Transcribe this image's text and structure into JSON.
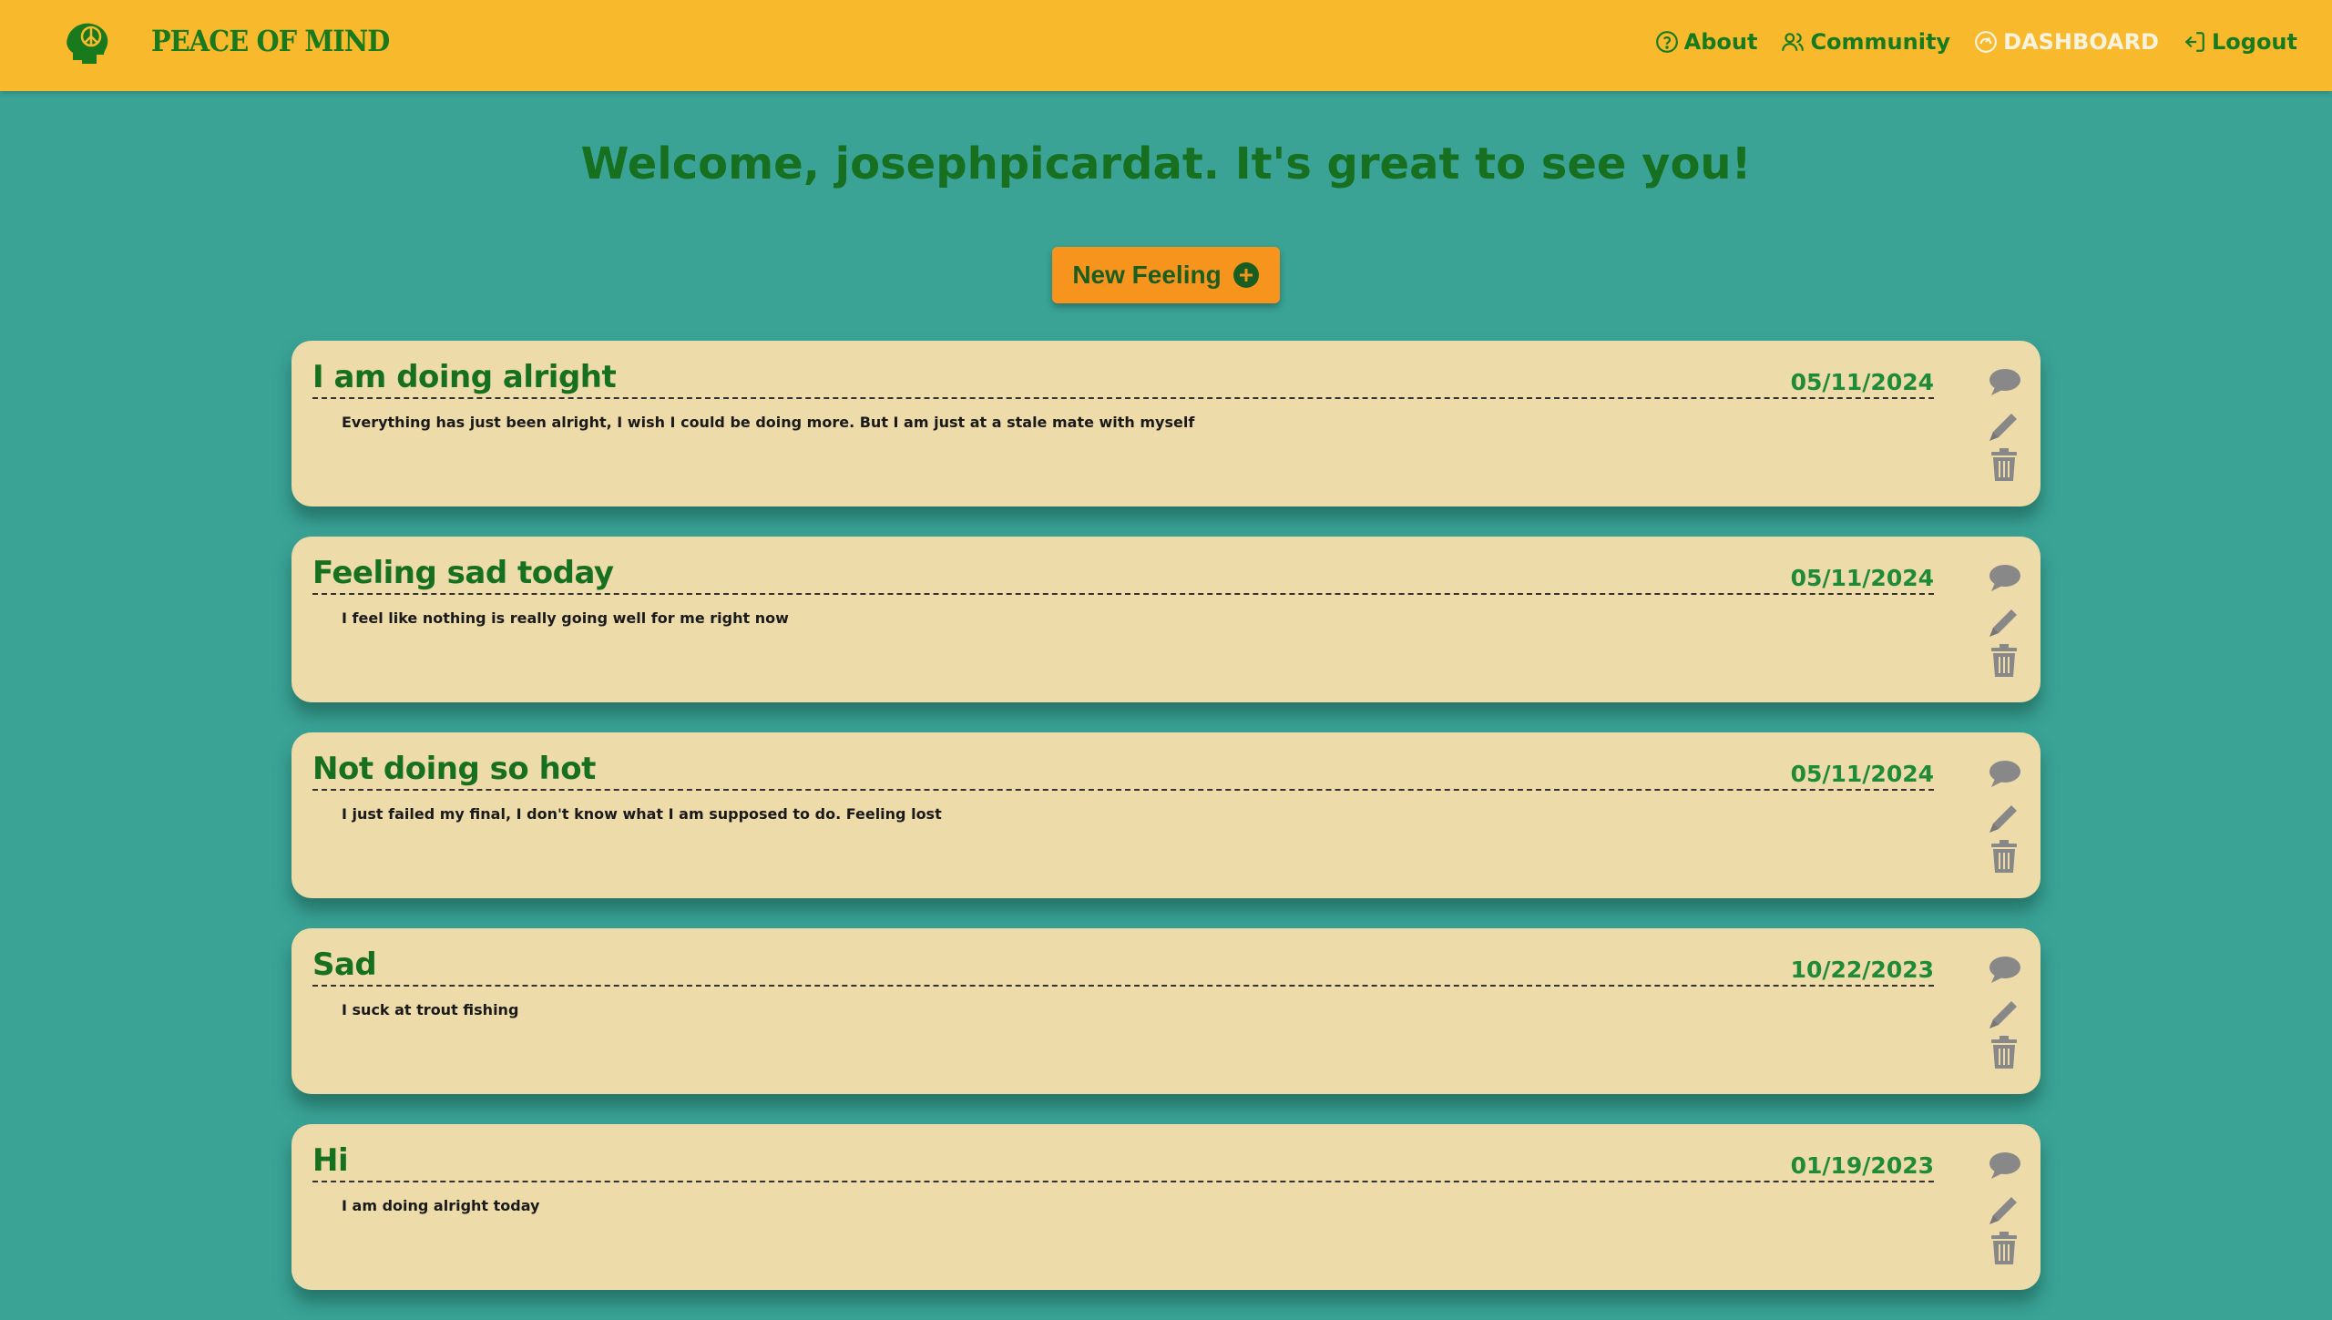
{
  "app": {
    "brand": "PEACE OF MIND",
    "logo_icon": "peace-head-icon"
  },
  "nav": {
    "about": "About",
    "community": "Community",
    "dashboard": "DASHBOARD",
    "logout": "Logout"
  },
  "colors": {
    "header": "#f9b92d",
    "background": "#3aa396",
    "card": "#eddba9",
    "accent_green": "#17701f",
    "button_orange": "#f7941d"
  },
  "welcome": "Welcome, josephpicardat. It's great to see you!",
  "new_feeling_label": "New Feeling",
  "entries": [
    {
      "title": "I am doing alright",
      "date": "05/11/2024",
      "body": "Everything has just been alright, I wish I could be doing more. But I am just at a stale mate with myself"
    },
    {
      "title": "Feeling sad today",
      "date": "05/11/2024",
      "body": "I feel like nothing is really going well for me right now"
    },
    {
      "title": "Not doing so hot",
      "date": "05/11/2024",
      "body": "I just failed my final, I don't know what I am supposed to do. Feeling lost"
    },
    {
      "title": "Sad",
      "date": "10/22/2023",
      "body": "I suck at trout fishing"
    },
    {
      "title": "Hi",
      "date": "01/19/2023",
      "body": "I am doing alright today"
    }
  ]
}
